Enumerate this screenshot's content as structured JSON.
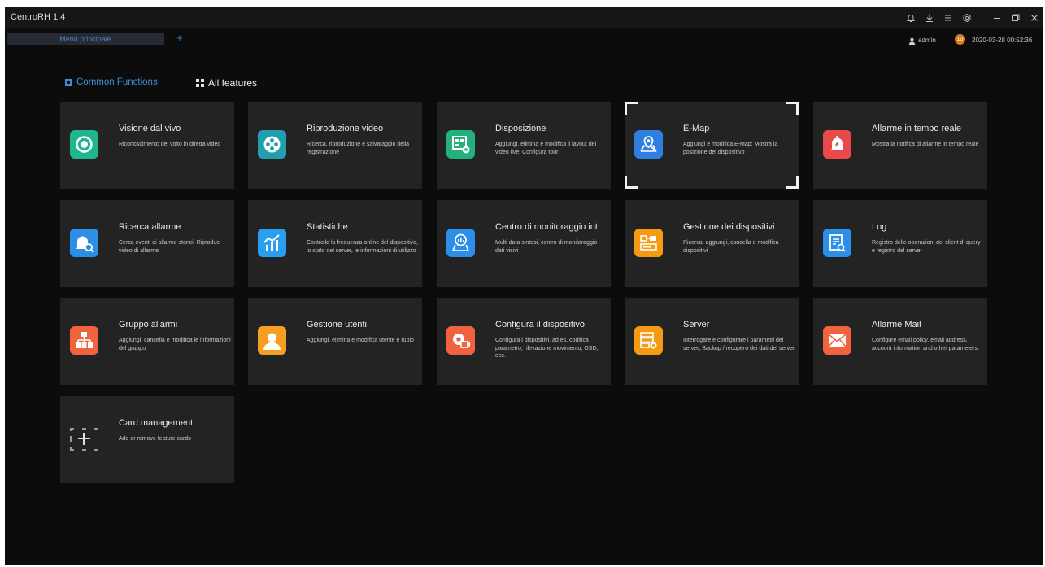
{
  "window": {
    "title": "CentroRH 1.4",
    "controls": [
      "bell-icon",
      "download-icon",
      "menu-icon",
      "settings-icon",
      "minimize-icon",
      "restore-icon",
      "close-icon"
    ]
  },
  "tabs": {
    "main_label": "Menù principale",
    "add_label": "+"
  },
  "status": {
    "user": "admin",
    "badge": "10",
    "datetime": "2020-03-28 00:52:36"
  },
  "nav": {
    "common_label": "Common Functions",
    "all_label": "All features"
  },
  "cards": [
    {
      "title": "Visione dal vivo",
      "desc": "Riconoscimento del volto in diretta video",
      "icon": "live-view-icon",
      "color": "#1fb58f"
    },
    {
      "title": "Riproduzione video",
      "desc": "Ricerca, riproduzione e salvataggio della registrazione",
      "icon": "film-reel-icon",
      "color": "#1f9fb0"
    },
    {
      "title": "Disposizione",
      "desc": "Aggiungi, elimina e modifica il layout del video live; Configura tour",
      "icon": "layout-icon",
      "color": "#24b07d"
    },
    {
      "title": "E-Map",
      "desc": "Aggiungi e modifica E-Map; Mostra la posizione del dispositivo",
      "icon": "map-pin-icon",
      "color": "#2f7fe0"
    },
    {
      "title": "Allarme in tempo reale",
      "desc": "Mostra la notifica di allarme in tempo reale",
      "icon": "alarm-bell-icon",
      "color": "#e84a4a"
    },
    {
      "title": "Ricerca allarme",
      "desc": "Cerca eventi di allarme storici; Riproduci video di allarme",
      "icon": "alarm-search-icon",
      "color": "#2b8fe8"
    },
    {
      "title": "Statistiche",
      "desc": "Controlla la frequenza online del dispositivo, lo stato del server, le informazioni di utilizzo",
      "icon": "chart-icon",
      "color": "#2a9ff0"
    },
    {
      "title": "Centro di monitoraggio int",
      "desc": "Multi data sintesi, centro di monitoraggio dati visivi",
      "icon": "monitor-map-icon",
      "color": "#2b8fe8"
    },
    {
      "title": "Gestione dei dispositivi",
      "desc": "Ricerca, aggiungi, cancella e modifica dispositivi",
      "icon": "device-icon",
      "color": "#f59a12"
    },
    {
      "title": "Log",
      "desc": "Registro delle operazioni del client di query e registro del server",
      "icon": "log-icon",
      "color": "#2b8fe8"
    },
    {
      "title": "Gruppo allarmi",
      "desc": "Aggiungi, cancella e modifica le informazioni del gruppo",
      "icon": "group-tree-icon",
      "color": "#f0633e"
    },
    {
      "title": "Gestione utenti",
      "desc": "Aggiungi, elimina e modifica utente e ruolo",
      "icon": "user-icon",
      "color": "#f5a020"
    },
    {
      "title": "Configura il dispositivo",
      "desc": "Configura i dispositivi, ad es. codifica parametro, rilevazione movimento, OSD, ecc.",
      "icon": "device-config-icon",
      "color": "#f0633e"
    },
    {
      "title": "Server",
      "desc": "Interrogare e configurare i parametri del server; Backup / recupero dei dati del server",
      "icon": "server-icon",
      "color": "#f59a12"
    },
    {
      "title": "Allarme Mail",
      "desc": "Configure email policy, email address, account information and other parameters",
      "icon": "mail-icon",
      "color": "#f0633e"
    }
  ],
  "card_management": {
    "title": "Card management",
    "desc": "Add or remove feature cards"
  }
}
